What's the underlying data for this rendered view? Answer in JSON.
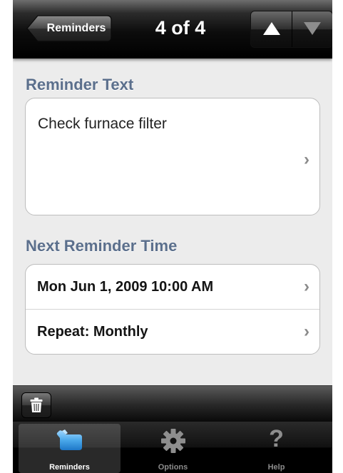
{
  "navbar": {
    "back_label": "Reminders",
    "title": "4 of 4",
    "up_icon": "triangle-up-icon",
    "down_icon": "triangle-down-icon"
  },
  "reminder_text": {
    "header": "Reminder Text",
    "value": "Check furnace filter"
  },
  "next_reminder": {
    "header": "Next Reminder Time",
    "rows": [
      {
        "label": "Mon Jun 1, 2009 10:00 AM"
      },
      {
        "label": "Repeat: Monthly"
      }
    ]
  },
  "chevron": "›",
  "toolbar": {
    "trash_icon": "trash-icon"
  },
  "tabbar": {
    "tabs": [
      {
        "label": "Reminders",
        "icon": "reminders-icon",
        "selected": true
      },
      {
        "label": "Options",
        "icon": "gear-icon",
        "selected": false
      },
      {
        "label": "Help",
        "icon": "question-mark-icon",
        "selected": false
      }
    ],
    "help_glyph": "?"
  },
  "colors": {
    "section_header": "#5b6f8c",
    "background": "#ececec",
    "accent_blue": "#5fb0ea"
  }
}
